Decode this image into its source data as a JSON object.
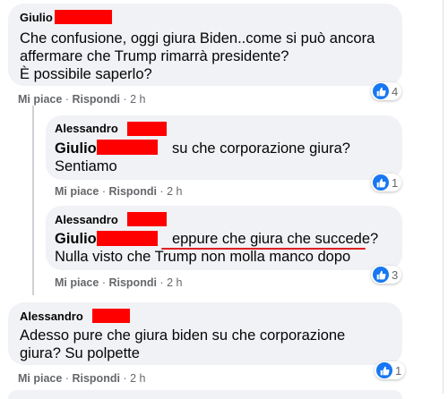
{
  "colors": {
    "bubble_bg": "#f0f2f5",
    "redaction": "#ff0000",
    "like_blue": "#1877f2",
    "meta_gray": "#65676b"
  },
  "comments": [
    {
      "author": "Giulio",
      "lines": [
        "Che confusione, oggi giura Biden..come si può ancora",
        "affermare che Trump rimarrà presidente?",
        "È possibile saperlo?"
      ],
      "like_label": "Mi piace",
      "reply_label": "Rispondi",
      "time": "2 h",
      "reactions": "4",
      "reaction_icon": "like-icon"
    },
    {
      "author": "Alessandro",
      "mention": "Giulio",
      "lines_after_mention": "su che corporazione giura?",
      "lines": [
        "Sentiamo"
      ],
      "like_label": "Mi piace",
      "reply_label": "Rispondi",
      "time": "2 h",
      "reactions": "1",
      "reaction_icon": "like-icon"
    },
    {
      "author": "Alessandro",
      "mention": "Giulio",
      "lines_after_mention": "eppure che giura che succede?",
      "lines": [
        "Nulla visto che Trump non molla manco dopo"
      ],
      "like_label": "Mi piace",
      "reply_label": "Rispondi",
      "time": "2 h",
      "reactions": "3",
      "reaction_icon": "like-icon"
    },
    {
      "author": "Alessandro",
      "lines": [
        "Adesso pure che giura biden su che corporazione",
        "giura? Su polpette"
      ],
      "like_label": "Mi piace",
      "reply_label": "Rispondi",
      "time": "2 h",
      "reactions": "1",
      "reaction_icon": "like-icon"
    }
  ],
  "separator": "·"
}
